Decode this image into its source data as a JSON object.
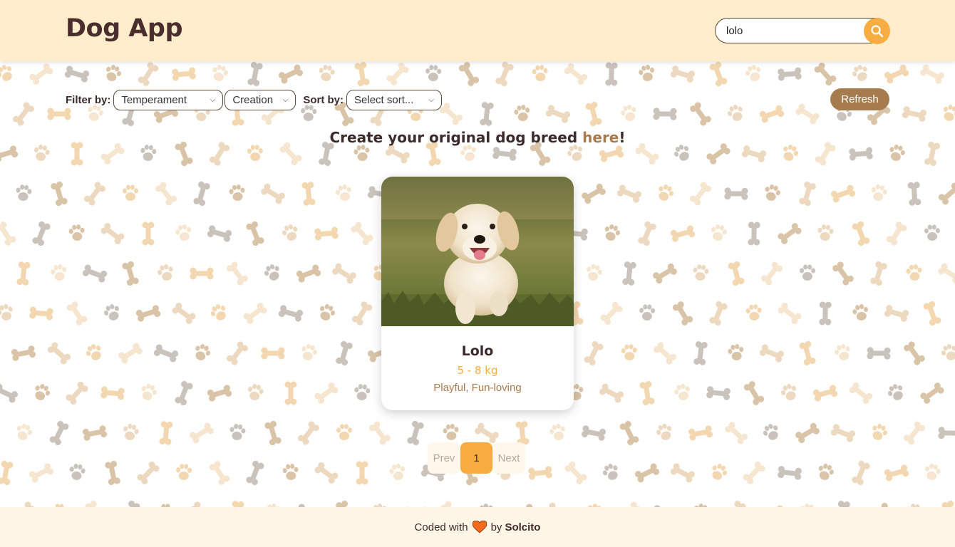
{
  "header": {
    "title": "Dog App",
    "search": {
      "value": "lolo",
      "placeholder": ""
    }
  },
  "toolbar": {
    "filter_label": "Filter by:",
    "temperament_select": "Temperament",
    "creation_select": "Creation",
    "sort_label": "Sort by:",
    "sort_select": "Select sort...",
    "refresh_label": "Refresh"
  },
  "create": {
    "prefix": "Create your original dog breed ",
    "link": "here",
    "suffix": "!"
  },
  "cards": [
    {
      "name": "Lolo",
      "weight": "5 - 8 kg",
      "temperaments": "Playful, Fun-loving"
    }
  ],
  "pagination": {
    "prev": "Prev",
    "current": "1",
    "next": "Next"
  },
  "footer": {
    "prefix": "Coded with",
    "by": "by",
    "author": "Solcito"
  },
  "colors": {
    "header_bg": "#ffedcc",
    "accent_orange": "#f7ad42",
    "accent_brown": "#a67c4e",
    "footer_bg": "#fff5e6",
    "heart": "#f26a1b"
  }
}
